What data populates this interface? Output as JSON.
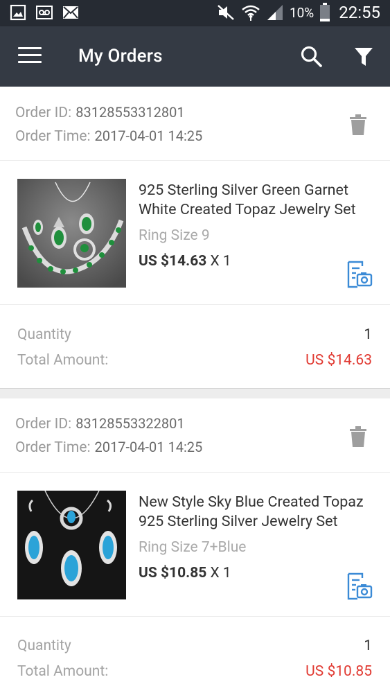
{
  "status_bar": {
    "icons_left": [
      "image-icon",
      "voicemail-icon",
      "mail-icon"
    ],
    "icons_right": [
      "mute-icon",
      "wifi-icon",
      "signal-icon"
    ],
    "battery": "10%",
    "time": "22:55"
  },
  "app_bar": {
    "title": "My Orders",
    "icons": [
      "menu-icon",
      "search-icon",
      "filter-icon"
    ]
  },
  "labels": {
    "order_id": "Order ID:",
    "order_time": "Order Time:",
    "quantity": "Quantity",
    "total_amount": "Total Amount:"
  },
  "orders": [
    {
      "order_id": "83128553312801",
      "order_time": "2017-04-01 14:25",
      "item": {
        "title": "925 Sterling Silver Green Garnet White Created Topaz Jewelry Set",
        "variant": "Ring Size 9",
        "price": "US $14.63",
        "qty_suffix": " X 1"
      },
      "quantity": "1",
      "total_amount": "US $14.63",
      "gem_color": "#1f8f3c"
    },
    {
      "order_id": "83128553322801",
      "order_time": "2017-04-01 14:25",
      "item": {
        "title": "New Style Sky Blue Created Topaz 925 Sterling Silver Jewelry Set",
        "variant": "Ring Size 7+Blue",
        "price": "US $10.85",
        "qty_suffix": " X 1"
      },
      "quantity": "1",
      "total_amount": "US $10.85",
      "gem_color": "#2ba3d8"
    }
  ],
  "colors": {
    "status_bar": "#262b33",
    "app_bar": "#343a44",
    "price_red": "#e13a32",
    "icon_blue": "#3a8ad6"
  }
}
